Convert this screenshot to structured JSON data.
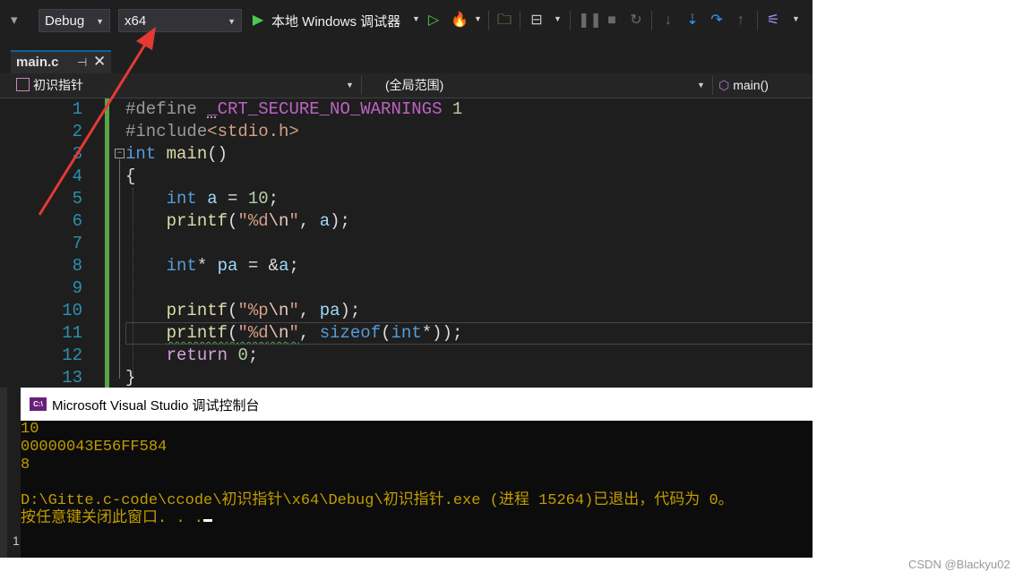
{
  "toolbar": {
    "config": "Debug",
    "platform": "x64",
    "run_label": "本地 Windows 调试器",
    "icons": [
      "start-debug-icon",
      "start-no-debug-icon",
      "hot-reload-icon",
      "open-folder-icon",
      "layout-icon",
      "pause-icon",
      "stop-icon",
      "restart-icon",
      "step-into-icon",
      "step-over-icon",
      "step-out-icon",
      "breakpoint-icon"
    ]
  },
  "tab": {
    "filename": "main.c",
    "pin": "⊣",
    "close": "✕"
  },
  "navbar": {
    "project": "初识指针",
    "scope": "(全局范围)",
    "function": "main()"
  },
  "editor": {
    "line_numbers": [
      "1",
      "2",
      "3",
      "4",
      "5",
      "6",
      "7",
      "8",
      "9",
      "10",
      "11",
      "12",
      "13"
    ],
    "colors": {
      "keyword": "#569cd6",
      "string": "#d69d85",
      "function": "#dcdcaa",
      "variable": "#9cdcfe",
      "line_number": "#2b91af"
    }
  },
  "console": {
    "title": "Microsoft Visual Studio 调试控制台",
    "icon_text": "C:\\",
    "lines": [
      "10",
      "00000043E56FF584",
      "8",
      "",
      "D:\\Gitte.c-code\\ccode\\初识指针\\x64\\Debug\\初识指针.exe (进程 15264)已退出，代码为 0。",
      "按任意键关闭此窗口. . ."
    ]
  },
  "side_number": "1",
  "watermark": "CSDN @Blackyu02",
  "annotation_color": "#e53935"
}
